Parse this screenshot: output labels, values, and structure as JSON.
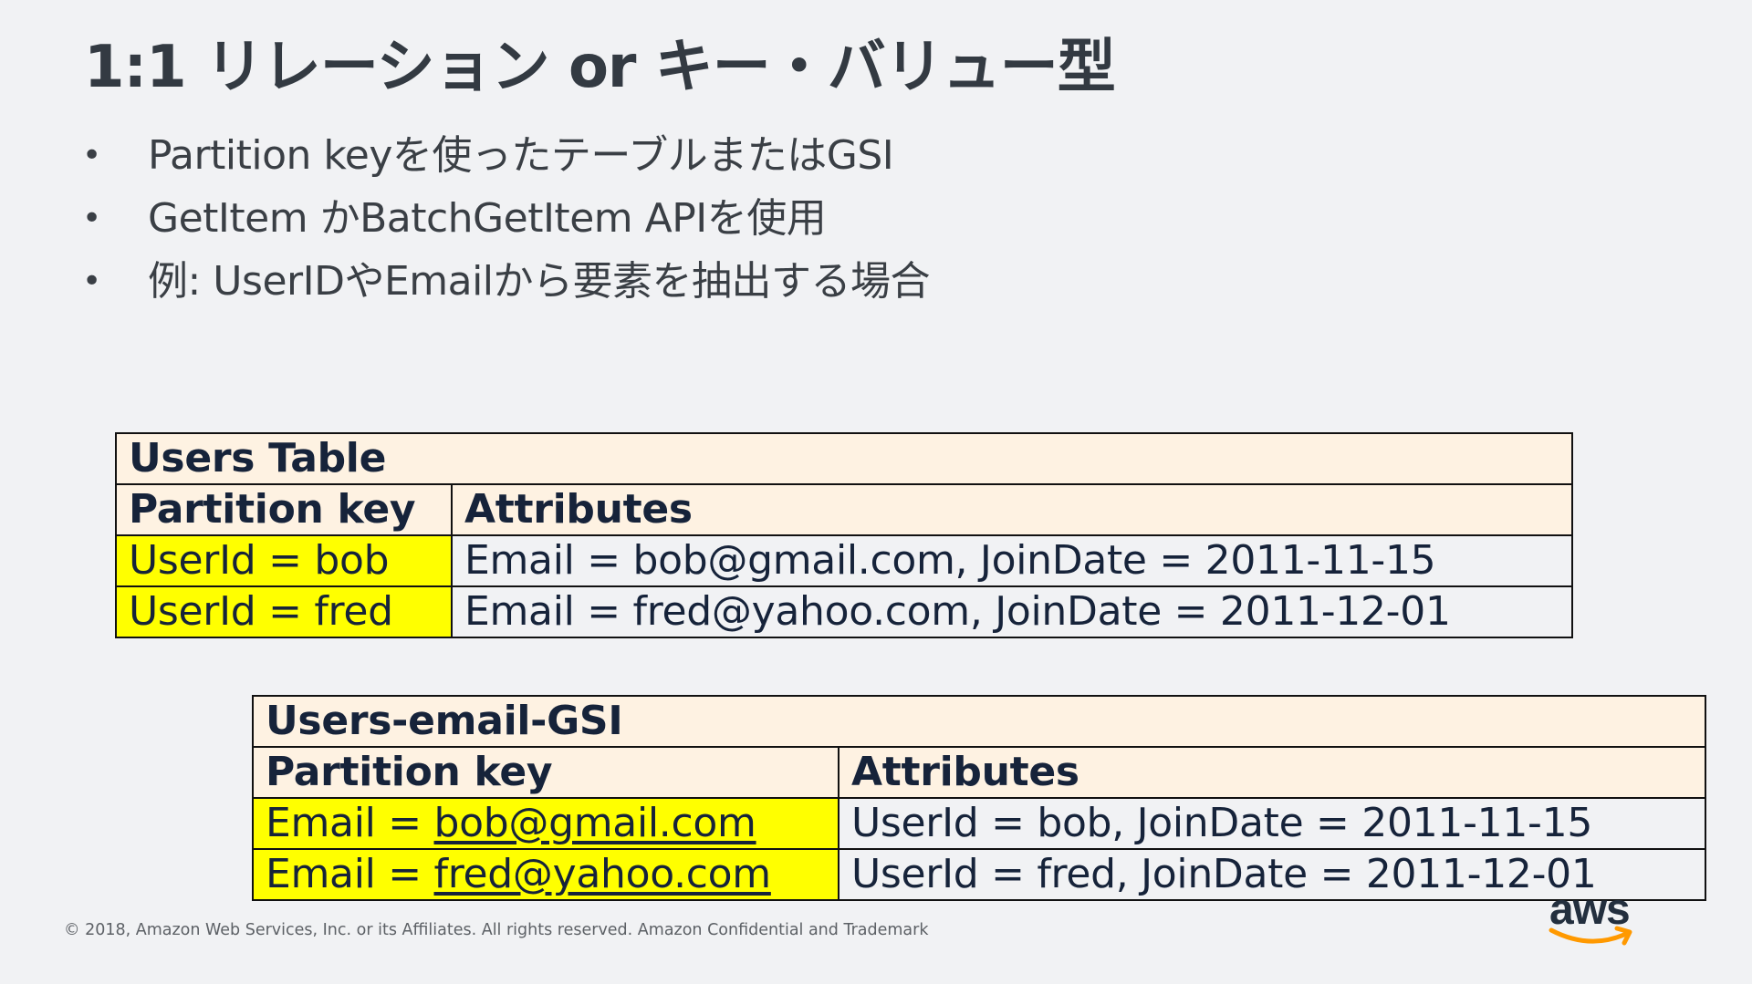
{
  "title": "1:1 リレーション or キー・バリュー型",
  "bullets": [
    {
      "marker": "•",
      "text": "Partition keyを使ったテーブルまたはGSI"
    },
    {
      "marker": "•",
      "text": "GetItem かBatchGetItem APIを使用"
    },
    {
      "marker": "•",
      "text": "例: UserIDやEmailから要素を抽出する場合"
    }
  ],
  "users_table": {
    "title": "Users Table",
    "headers": [
      "Partition key",
      "Attributes"
    ],
    "rows": [
      [
        "UserId = bob",
        "Email = bob@gmail.com, JoinDate = 2011-11-15"
      ],
      [
        "UserId = fred",
        "Email = fred@yahoo.com, JoinDate = 2011-12-01"
      ]
    ]
  },
  "gsi_table": {
    "title": "Users-email-GSI",
    "headers": [
      "Partition key",
      "Attributes"
    ],
    "rows": [
      {
        "key_prefix": "Email = ",
        "key_link": "bob@gmail.com",
        "attributes": "UserId = bob, JoinDate = 2011-11-15"
      },
      {
        "key_prefix": "Email = ",
        "key_link": "fred@yahoo.com",
        "attributes": "UserId = fred, JoinDate = 2011-12-01"
      }
    ]
  },
  "footer": "© 2018, Amazon Web Services, Inc. or its Affiliates. All rights reserved. Amazon Confidential and Trademark",
  "logo": {
    "text": "aws",
    "icon": "aws-smile-logo",
    "accent_color": "#ff9900"
  },
  "colors": {
    "background": "#f1f2f4",
    "key_highlight": "#ffff00",
    "header_fill": "#fef2e2",
    "text": "#16233a"
  }
}
